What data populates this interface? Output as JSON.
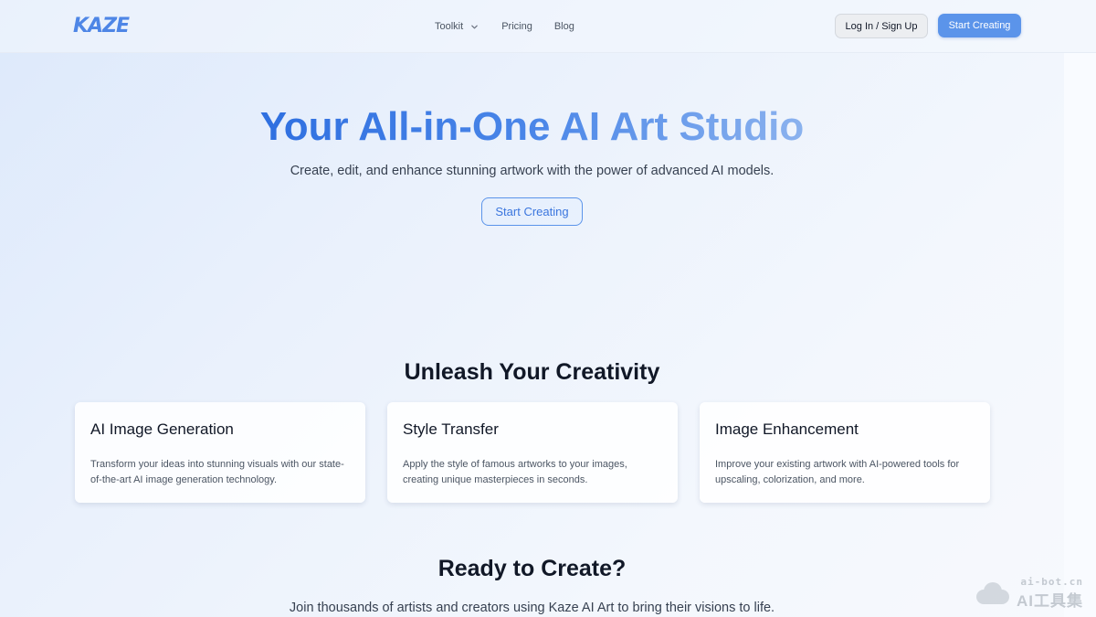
{
  "header": {
    "logo_text": "KAZE",
    "nav": [
      {
        "label": "Toolkit",
        "icon": "chevron-down-icon"
      },
      {
        "label": "Pricing"
      },
      {
        "label": "Blog"
      }
    ],
    "login_label": "Log In / Sign Up",
    "start_label": "Start Creating"
  },
  "hero": {
    "title": "Your All-in-One AI Art Studio",
    "subtitle": "Create, edit, and enhance stunning artwork with the power of advanced AI models.",
    "button_label": "Start Creating"
  },
  "features": {
    "title": "Unleash Your Creativity",
    "cards": [
      {
        "title": "AI Image Generation",
        "description": "Transform your ideas into stunning visuals with our state-of-the-art AI image generation technology."
      },
      {
        "title": "Style Transfer",
        "description": "Apply the style of famous artworks to your images, creating unique masterpieces in seconds."
      },
      {
        "title": "Image Enhancement",
        "description": "Improve your existing artwork with AI-powered tools for upscaling, colorization, and more."
      }
    ]
  },
  "cta": {
    "title": "Ready to Create?",
    "subtitle": "Join thousands of artists and creators using Kaze AI Art to bring their visions to life."
  },
  "watermark": {
    "url": "ai-bot.cn",
    "name": "AI工具集"
  },
  "colors": {
    "accent": "#5b94ea",
    "title_gradient_start": "#2f6fe0",
    "title_gradient_end": "#8bb2ee"
  }
}
